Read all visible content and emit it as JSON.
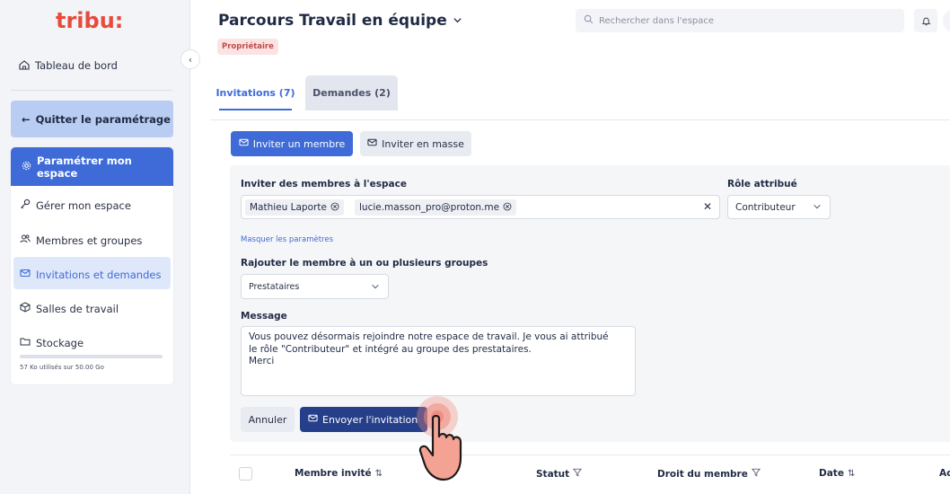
{
  "brand": {
    "logo_text": "tribu:"
  },
  "sidebar": {
    "dashboard": "Tableau de bord",
    "quit": "Quitter le paramétrage",
    "config": "Paramétrer mon espace",
    "items": [
      {
        "label": "Gérer mon espace",
        "icon": "key-icon"
      },
      {
        "label": "Membres et groupes",
        "icon": "users-icon"
      },
      {
        "label": "Invitations et demandes",
        "icon": "mail-icon",
        "active": true
      },
      {
        "label": "Salles de travail",
        "icon": "cube-icon"
      },
      {
        "label": "Stockage",
        "icon": "folder-icon"
      }
    ],
    "storage_text": "57 Ko utilisés sur 50.00 Go",
    "storage_fraction": 0.0
  },
  "header": {
    "title": "Parcours Travail en équipe",
    "badge": "Propriétaire",
    "search_placeholder": "Rechercher dans l'espace"
  },
  "tabs": [
    {
      "label": "Invitations (7)",
      "active": true
    },
    {
      "label": "Demandes (2)",
      "active": false
    }
  ],
  "actions": {
    "invite_member": "Inviter un membre",
    "invite_mass": "Inviter en masse"
  },
  "form": {
    "members_label": "Inviter des membres à l'espace",
    "chips": [
      "Mathieu Laporte",
      "lucie.masson_pro@proton.me"
    ],
    "role_label": "Rôle attribué",
    "role_value": "Contributeur",
    "hide_params": "Masquer les paramètres",
    "group_label": "Rajouter le membre à un ou plusieurs groupes",
    "group_value": "Prestataires",
    "message_label": "Message",
    "message_value": "Vous pouvez désormais rejoindre notre espace de travail. Je vous ai attribué\nle rôle \"Contributeur\" et intégré au groupe des prestataires.\nMerci",
    "cancel": "Annuler",
    "send": "Envoyer l'invitation"
  },
  "table": {
    "columns": [
      "Membre invité",
      "Statut",
      "Droit du membre",
      "Date",
      "Ac"
    ]
  },
  "colors": {
    "primary": "#3e6bd8",
    "primary_dark": "#253f8a",
    "badge_bg": "#fbe3e3",
    "badge_text": "#c44a4a",
    "cursor": "#f08a7c"
  }
}
